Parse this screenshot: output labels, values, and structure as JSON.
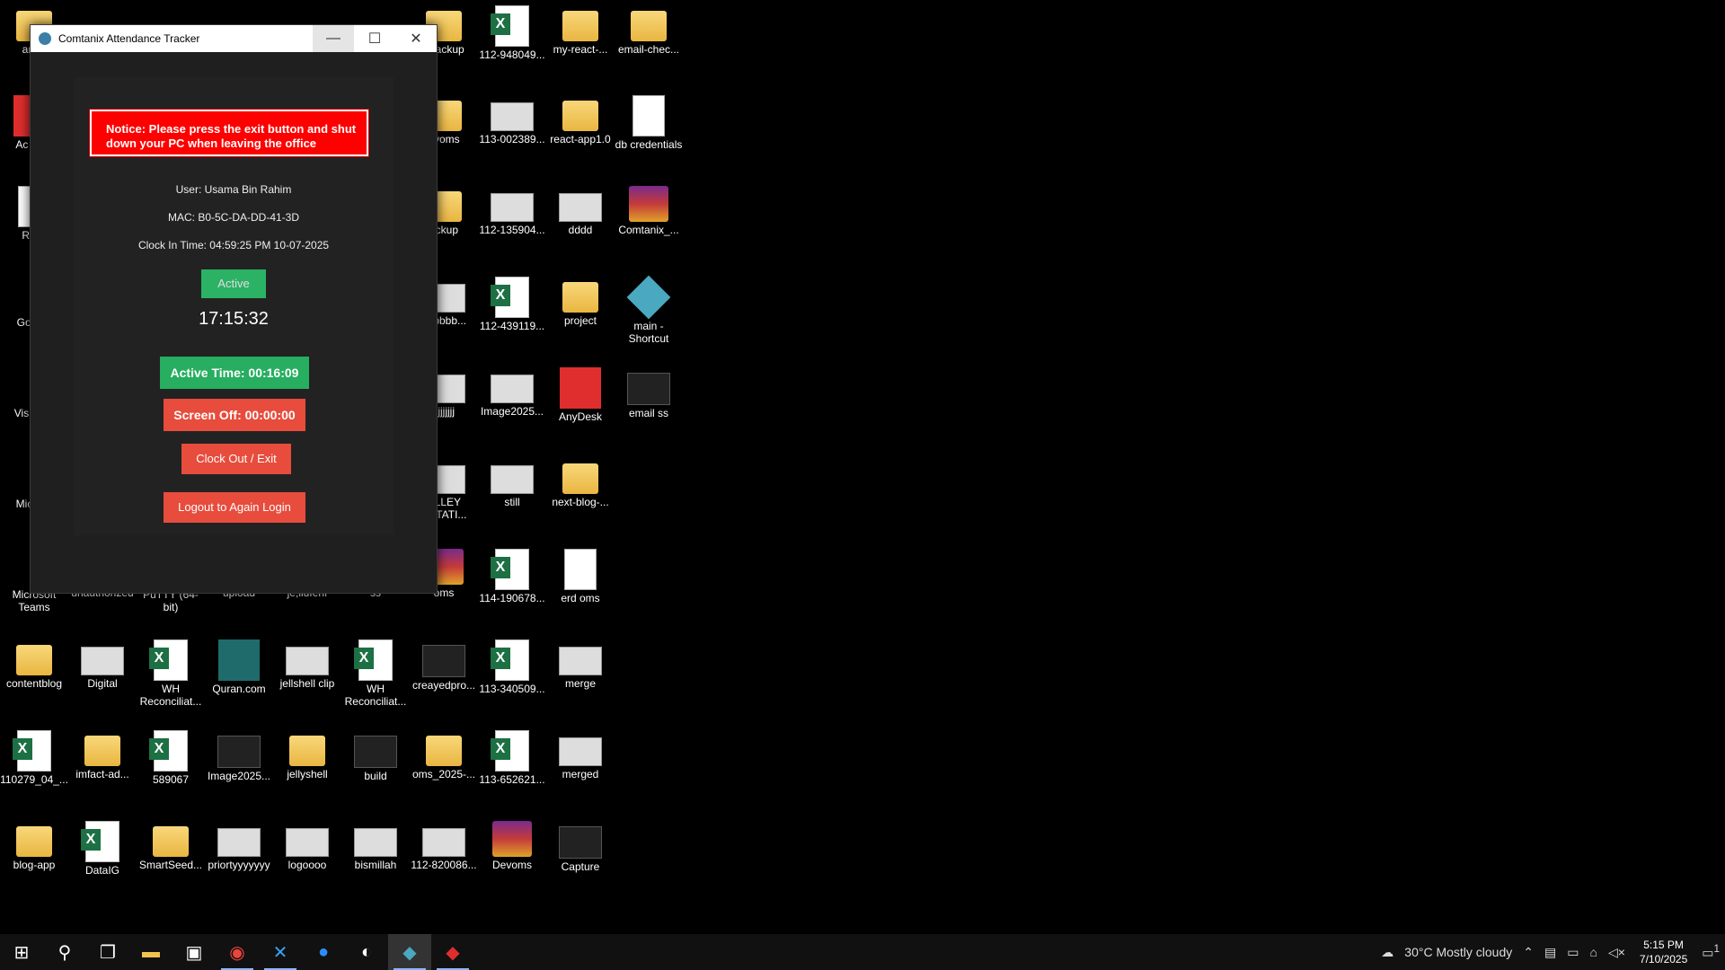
{
  "window": {
    "title": "Comtanix Attendance Tracker",
    "minimize_glyph": "—",
    "maximize_glyph": "☐",
    "close_glyph": "✕",
    "notice": "Notice: Please press the exit button and shut down your PC when leaving the office",
    "user": "User: Usama Bin Rahim",
    "mac": "MAC: B0-5C-DA-DD-41-3D",
    "clock_in": "Clock In Time: 04:59:25 PM 10-07-2025",
    "status": "Active",
    "clock": "17:15:32",
    "active_time": "Active Time: 00:16:09",
    "screen_off": "Screen Off: 00:00:00",
    "clock_out": "Clock Out / Exit",
    "logout": "Logout to Again Login"
  },
  "desktop_icons": [
    {
      "label": "amz-",
      "type": "folder"
    },
    {
      "label": "Ac Acro",
      "type": "red"
    },
    {
      "label": "Recy",
      "type": "doc"
    },
    {
      "label": "Go Chr",
      "type": "app"
    },
    {
      "label": "Visual C",
      "type": "app"
    },
    {
      "label": "Micr Ed",
      "type": "app"
    },
    {
      "label": "Microsoft Teams",
      "type": "app"
    },
    {
      "label": "unauthorized",
      "type": "folder"
    },
    {
      "label": "PuTTY (64-bit)",
      "type": "app"
    },
    {
      "label": "upload",
      "type": "folder"
    },
    {
      "label": "je;llufehf",
      "type": "img"
    },
    {
      "label": "ss",
      "type": "img"
    },
    {
      "label": "_backup",
      "type": "folder"
    },
    {
      "label": "evoms",
      "type": "folder"
    },
    {
      "label": "ackup",
      "type": "folder"
    },
    {
      "label": "obbbbb...",
      "type": "img"
    },
    {
      "label": "jjjjjjjjj",
      "type": "img"
    },
    {
      "label": "ULLEY ENTATI...",
      "type": "img"
    },
    {
      "label": "oms",
      "type": "rar"
    },
    {
      "label": "112-948049...",
      "type": "excel"
    },
    {
      "label": "113-002389...",
      "type": "img"
    },
    {
      "label": "112-135904...",
      "type": "img"
    },
    {
      "label": "112-439119...",
      "type": "excel"
    },
    {
      "label": "Image2025...",
      "type": "img"
    },
    {
      "label": "still",
      "type": "img"
    },
    {
      "label": "114-190678...",
      "type": "excel"
    },
    {
      "label": "my-react-...",
      "type": "folder"
    },
    {
      "label": "react-app1.0",
      "type": "folder"
    },
    {
      "label": "dddd",
      "type": "img"
    },
    {
      "label": "project",
      "type": "folder"
    },
    {
      "label": "AnyDesk",
      "type": "red"
    },
    {
      "label": "next-blog-...",
      "type": "folder"
    },
    {
      "label": "erd oms",
      "type": "doc"
    },
    {
      "label": "email-chec...",
      "type": "folder"
    },
    {
      "label": "db credentials",
      "type": "doc"
    },
    {
      "label": "Comtanix_...",
      "type": "rar"
    },
    {
      "label": "main - Shortcut",
      "type": "diamond"
    },
    {
      "label": "email ss",
      "type": "dark"
    },
    {
      "label": "contentblog",
      "type": "folder"
    },
    {
      "label": "Digital",
      "type": "img"
    },
    {
      "label": "WH Reconciliat...",
      "type": "excel"
    },
    {
      "label": "Quran.com",
      "type": "teal"
    },
    {
      "label": "jellshell clip",
      "type": "img"
    },
    {
      "label": "WH Reconciliat...",
      "type": "excel"
    },
    {
      "label": "creayedpro...",
      "type": "dark"
    },
    {
      "label": "113-340509...",
      "type": "excel"
    },
    {
      "label": "merge",
      "type": "img"
    },
    {
      "label": "110279_04_...",
      "type": "excel"
    },
    {
      "label": "imfact-ad...",
      "type": "folder"
    },
    {
      "label": "589067",
      "type": "excel"
    },
    {
      "label": "Image2025...",
      "type": "dark"
    },
    {
      "label": "jellyshell",
      "type": "folder"
    },
    {
      "label": "build",
      "type": "dark"
    },
    {
      "label": "oms_2025-...",
      "type": "folder"
    },
    {
      "label": "113-652621...",
      "type": "excel"
    },
    {
      "label": "merged",
      "type": "img"
    },
    {
      "label": "blog-app",
      "type": "folder"
    },
    {
      "label": "DataIG",
      "type": "excel"
    },
    {
      "label": "SmartSeed...",
      "type": "folder"
    },
    {
      "label": "priortyyyyyyy",
      "type": "img"
    },
    {
      "label": "logoooo",
      "type": "img"
    },
    {
      "label": "bismillah",
      "type": "img"
    },
    {
      "label": "112-820086...",
      "type": "img"
    },
    {
      "label": "Devoms",
      "type": "rar"
    },
    {
      "label": "Capture",
      "type": "dark"
    }
  ],
  "taskbar": {
    "weather": "30°C  Mostly cloudy",
    "time": "5:15 PM",
    "date": "7/10/2025",
    "notification_count": "1"
  }
}
